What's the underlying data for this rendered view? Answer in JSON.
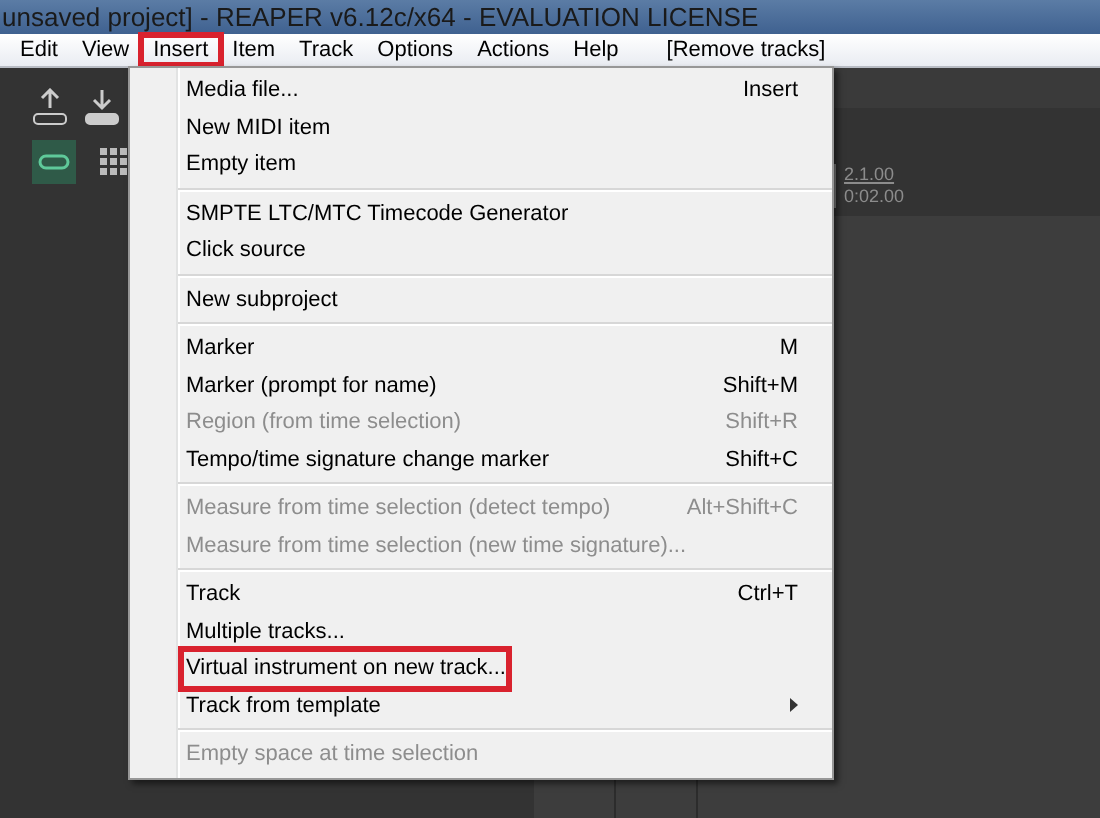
{
  "window": {
    "title": "unsaved project] - REAPER v6.12c/x64 - EVALUATION LICENSE"
  },
  "menubar": [
    {
      "label": "Edit",
      "highlighted": false
    },
    {
      "label": "View",
      "highlighted": false
    },
    {
      "label": "Insert",
      "highlighted": true
    },
    {
      "label": "Item",
      "highlighted": false
    },
    {
      "label": "Track",
      "highlighted": false
    },
    {
      "label": "Options",
      "highlighted": false
    },
    {
      "label": "Actions",
      "highlighted": false
    },
    {
      "label": "Help",
      "highlighted": false
    },
    {
      "label": "[Remove tracks]",
      "highlighted": false
    }
  ],
  "ruler": {
    "measure": "2.1.00",
    "time": "0:02.00"
  },
  "menu": [
    {
      "kind": "item",
      "label": "Media file...",
      "shortcut": "Insert",
      "disabled": false,
      "highlighted": false
    },
    {
      "kind": "item",
      "label": "New MIDI item",
      "disabled": false,
      "highlighted": false
    },
    {
      "kind": "item",
      "label": "Empty item",
      "disabled": false,
      "highlighted": false
    },
    {
      "kind": "separator"
    },
    {
      "kind": "item",
      "label": "SMPTE LTC/MTC Timecode Generator",
      "disabled": false,
      "highlighted": false
    },
    {
      "kind": "item",
      "label": "Click source",
      "disabled": false,
      "highlighted": false
    },
    {
      "kind": "separator"
    },
    {
      "kind": "item",
      "label": "New subproject",
      "disabled": false,
      "highlighted": false
    },
    {
      "kind": "separator"
    },
    {
      "kind": "item",
      "label": "Marker",
      "shortcut": "M",
      "disabled": false,
      "highlighted": false
    },
    {
      "kind": "item",
      "label": "Marker (prompt for name)",
      "shortcut": "Shift+M",
      "disabled": false,
      "highlighted": false
    },
    {
      "kind": "item",
      "label": "Region (from time selection)",
      "shortcut": "Shift+R",
      "disabled": true,
      "highlighted": false
    },
    {
      "kind": "item",
      "label": "Tempo/time signature change marker",
      "shortcut": "Shift+C",
      "disabled": false,
      "highlighted": false
    },
    {
      "kind": "separator"
    },
    {
      "kind": "item",
      "label": "Measure from time selection (detect tempo)",
      "shortcut": "Alt+Shift+C",
      "disabled": true,
      "highlighted": false
    },
    {
      "kind": "item",
      "label": "Measure from time selection (new time signature)...",
      "disabled": true,
      "highlighted": false
    },
    {
      "kind": "separator"
    },
    {
      "kind": "item",
      "label": "Track",
      "shortcut": "Ctrl+T",
      "disabled": false,
      "highlighted": false
    },
    {
      "kind": "item",
      "label": "Multiple tracks...",
      "disabled": false,
      "highlighted": false
    },
    {
      "kind": "item",
      "label": "Virtual instrument on new track...",
      "disabled": false,
      "highlighted": true
    },
    {
      "kind": "submenu",
      "label": "Track from template",
      "disabled": false,
      "highlighted": false
    },
    {
      "kind": "separator"
    },
    {
      "kind": "item",
      "label": "Empty space at time selection",
      "disabled": true,
      "highlighted": false
    }
  ]
}
